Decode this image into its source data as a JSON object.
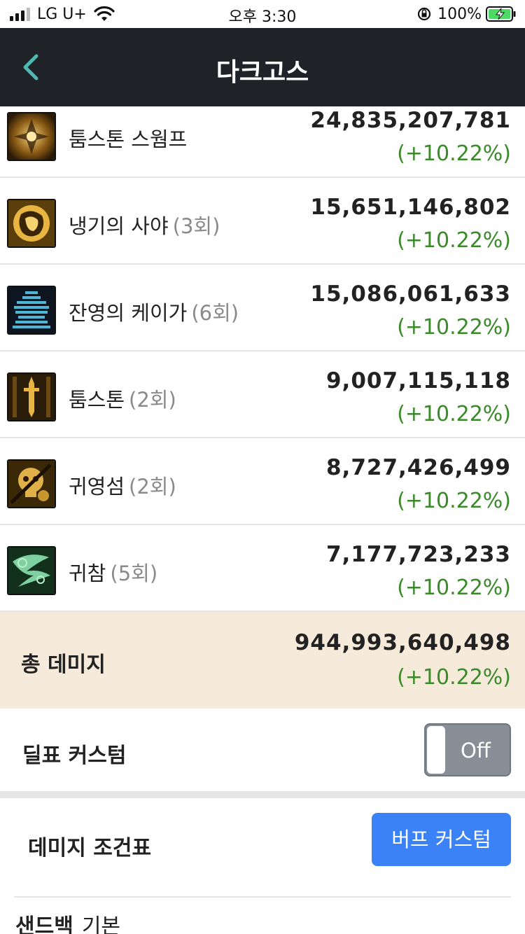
{
  "status_bar": {
    "carrier": "LG U+",
    "time": "오후 3:30",
    "battery": "100%"
  },
  "nav": {
    "title": "다크고스",
    "back_icon": "chevron-left-icon"
  },
  "skills": [
    {
      "name": "툼스톤 스웜프",
      "count": "",
      "damage": "24,835,207,781",
      "percent": "(+10.22%)",
      "icon": "swamp-skill-icon"
    },
    {
      "name": "냉기의 사야",
      "count": "(3회)",
      "damage": "15,651,146,802",
      "percent": "(+10.22%)",
      "icon": "frost-skill-icon"
    },
    {
      "name": "잔영의 케이가",
      "count": "(6회)",
      "damage": "15,086,061,633",
      "percent": "(+10.22%)",
      "icon": "afterimage-skill-icon"
    },
    {
      "name": "툼스톤",
      "count": "(2회)",
      "damage": "9,007,115,118",
      "percent": "(+10.22%)",
      "icon": "tombstone-skill-icon"
    },
    {
      "name": "귀영섬",
      "count": "(2회)",
      "damage": "8,727,426,499",
      "percent": "(+10.22%)",
      "icon": "ghost-flash-skill-icon"
    },
    {
      "name": "귀참",
      "count": "(5회)",
      "damage": "7,177,723,233",
      "percent": "(+10.22%)",
      "icon": "ghost-slash-skill-icon"
    }
  ],
  "total": {
    "label": "총 데미지",
    "damage": "944,993,640,498",
    "percent": "(+10.22%)"
  },
  "custom": {
    "label": "딜표 커스텀",
    "toggle": "Off"
  },
  "condition": {
    "label": "데미지 조건표",
    "button": "버프 커스텀"
  },
  "sandbag": {
    "label": "샌드백",
    "value": "기본"
  },
  "colors": {
    "nav_bg": "#1f2227",
    "accent_teal": "#4fb8b0",
    "percent_green": "#3a8a2a",
    "total_bg": "#f6ebdb",
    "button_blue": "#3b82f6",
    "toggle_gray": "#878e96"
  }
}
